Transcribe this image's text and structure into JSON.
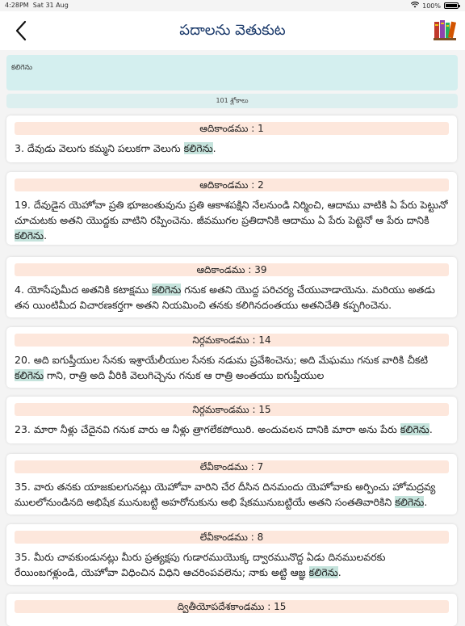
{
  "status": {
    "time": "4:28PM",
    "date": "Sat 31 Aug",
    "battery": "100%"
  },
  "header": {
    "title": "పదాలను వెతుకుట"
  },
  "search": {
    "value": "కలిగెను"
  },
  "results_count": "101 శ్లోకాలు",
  "keyword": "కలిగెను",
  "results": [
    {
      "ref": "ఆదికాండము : 1",
      "text": "3. దేవుడు వెలుగు కమ్మని  పలుకగా వెలుగు కలిగెను."
    },
    {
      "ref": "ఆదికాండము : 2",
      "text": "19. దేవుడైన యెహోవా ప్రతి భూజంతువును ప్రతి ఆకాశపక్షిని నేలనుండి నిర్మించి, ఆదాము వాటికి ఏ పేరు పెట్టునో చూచుటకు అతని యొద్దకు వాటిని రప్పించెను. జీవముగల ప్రతిదానికి ఆదాము ఏ పేరు పెట్టెనో ఆ పేరు దానికి కలిగెను."
    },
    {
      "ref": "ఆదికాండము : 39",
      "text": "4. యోసేపుమీద అతనికి కటాక్షము కలిగెను గనుక అతని యొద్ద పరిచర్య చేయువాడాయెను. మరియు అతడు తన యింటిమీద విచారణకర్తగా అతని నియమించి తనకు కలిగినదంతయు అతనిచేతి కప్పగించెను."
    },
    {
      "ref": "నిర్గమకాండము : 14",
      "text": "20. అది ఐగుప్తీయుల సేనకు ఇశ్రాయేలీయుల సేనకు నడుమ ప్రవేశించెను; అది మేఘము గనుక వారికి చీకటి కలిగెను గాని, రాత్రి అది వీరికి వెలుగిచ్చెను గనుక ఆ రాత్రి అంతయు ఐగుప్తీయుల"
    },
    {
      "ref": "నిర్గమకాండము : 15",
      "text": "23. మారా నీళ్లు చేదైనవి గనుక వారు ఆ నీళ్లు త్రాగలేకపోయిరి. అందువలన దానికి మారా అను  పేరు  కలిగెను."
    },
    {
      "ref": "లేవీకాండము : 7",
      "text": "35. వారు తనకు యాజకులగునట్లు యెహోవా వారిని చేర దీసిన దినమందు యెహోవాకు అర్పించు హోమద్రవ్య ములలోనుండినది అభిషేక మునుబట్టి అహరోనుకును అభి షేకమునుబట్టియే  అతని సంతతివారికిని కలిగెను."
    },
    {
      "ref": "లేవీకాండము : 8",
      "text": "35. మీరు చావకుండునట్లు మీరు ప్రత్యక్షపు గుడారముయొక్క ద్వారమునొద్ద ఏడు దినములవరకు రేయింబగళ్లుండి, యెహోవా విధించిన విధిని ఆచరింపవలెను; నాకు అట్టి ఆజ్ఞ కలిగెను."
    },
    {
      "ref": "ద్వితీయోపదేశకాండము : 15",
      "text": ""
    }
  ]
}
